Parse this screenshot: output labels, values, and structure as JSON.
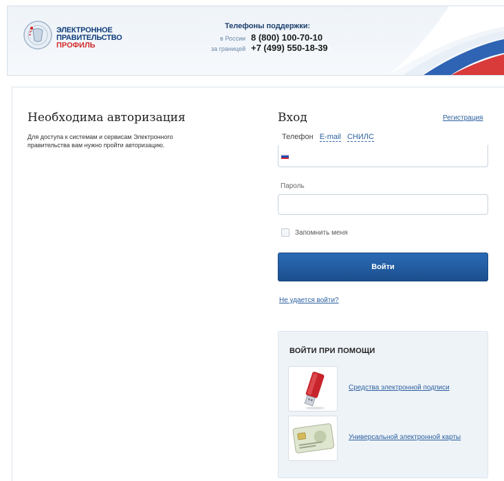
{
  "header": {
    "brand_line1": "ЭЛЕКТРОННОЕ",
    "brand_line2": "ПРАВИТЕЛЬСТВО",
    "brand_line3": "ПРОФИЛЬ",
    "support_title": "Телефоны поддержки:",
    "russia_label": "в России",
    "russia_phone": "8 (800) 100-70-10",
    "abroad_label": "за границей",
    "abroad_phone": "+7 (499) 550-18-39"
  },
  "left": {
    "title": "Необходима авторизация",
    "description": "Для доступа к системам и сервисам Электронного правительства вам нужно пройти авторизацию."
  },
  "login": {
    "title": "Вход",
    "register_link": "Регистрация",
    "tabs": [
      {
        "label": "Телефон",
        "active": true
      },
      {
        "label": "E-mail",
        "active": false
      },
      {
        "label": "СНИЛС",
        "active": false
      }
    ],
    "phone_value": "",
    "password_label": "Пароль",
    "password_value": "",
    "remember_label": "Запомнить меня",
    "submit_label": "Войти",
    "cant_login_link": "Не удается войти?"
  },
  "alt_login": {
    "title": "ВОЙТИ ПРИ ПОМОЩИ",
    "items": [
      {
        "label": "Средства электронной подписи",
        "icon": "usb-token-icon"
      },
      {
        "label": "Универсальной электронной карты",
        "icon": "smart-card-icon"
      }
    ]
  },
  "colors": {
    "primary_button": "#1f5da0",
    "link": "#2a5f9e",
    "brand_red": "#d22a2a",
    "brand_blue": "#0e3d7a"
  }
}
